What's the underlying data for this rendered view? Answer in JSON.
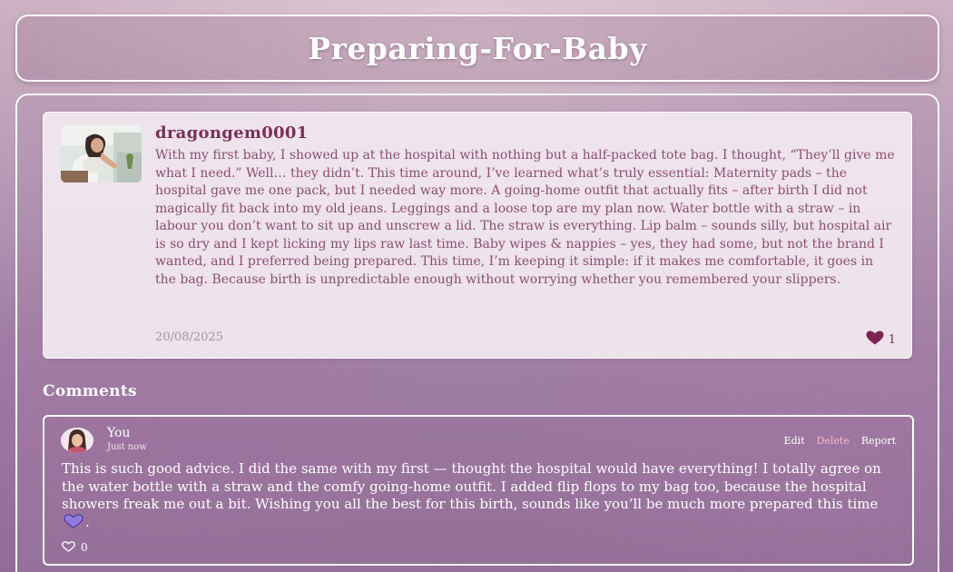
{
  "page": {
    "title": "Preparing-For-Baby"
  },
  "post": {
    "username": "dragongem0001",
    "body": "With my first baby, I showed up at the hospital with nothing but a half-packed tote bag. I thought, “They’ll give me what I need.” Well… they didn’t. This time around, I’ve learned what’s truly essential: Maternity pads – the hospital gave me one pack, but I needed way more. A going-home outfit that actually fits – after birth I did not magically fit back into my old jeans. Leggings and a loose top are my plan now. Water bottle with a straw – in labour you don’t want to sit up and unscrew a lid. The straw is everything. Lip balm – sounds silly, but hospital air is so dry and I kept licking my lips raw last time. Baby wipes & nappies – yes, they had some, but not the brand I wanted, and I preferred being prepared. This time, I’m keeping it simple: if it makes me comfortable, it goes in the bag. Because birth is unpredictable enough without worrying whether you remembered your slippers.",
    "date": "20/08/2025",
    "like_count": "1",
    "avatar_icon": "pregnant-woman-photo",
    "like_icon": "heart-filled-icon",
    "like_color": "#7b2352"
  },
  "comments": {
    "heading": "Comments",
    "items": [
      {
        "author": "You",
        "time": "Just now",
        "actions": {
          "edit": "Edit",
          "delete": "Delete",
          "report": "Report"
        },
        "body_before_emoji": "This is such good advice. I did the same with my first — thought the hospital would have everything! I totally agree on the water bottle with a straw and the comfy going-home outfit. I added flip flops to my bag too, because the hospital showers freak me out a bit. Wishing you all the best for this birth, sounds like you’ll be much more prepared this time",
        "emoji": "purple-heart",
        "body_after_emoji": ".",
        "like_count": "0",
        "like_icon": "heart-outline-icon",
        "delete_color": "#f6b8cf"
      }
    ]
  }
}
